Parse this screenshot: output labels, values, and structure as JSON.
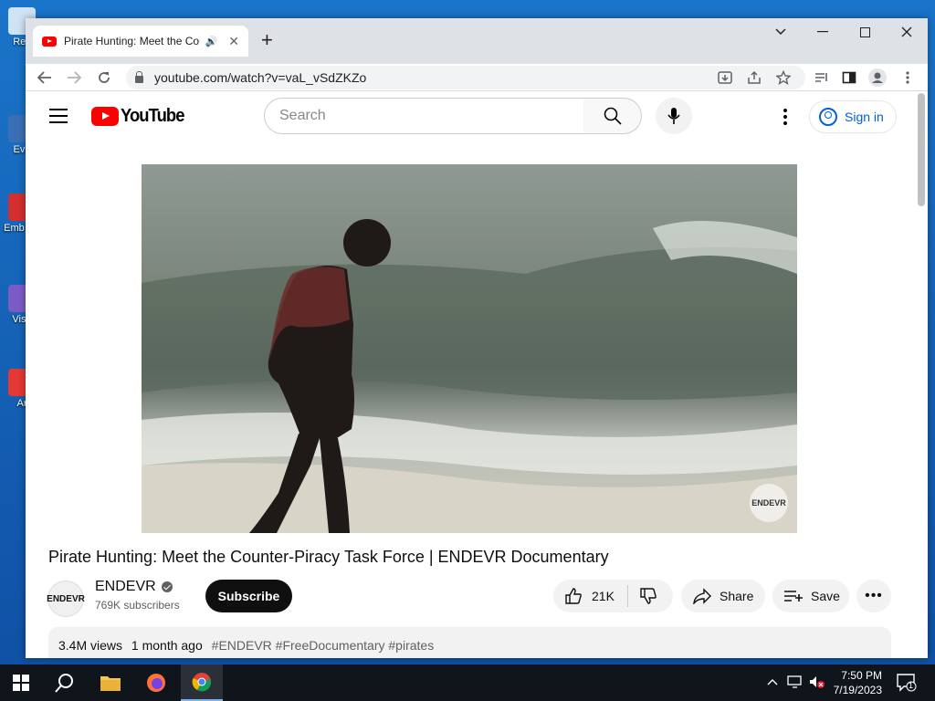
{
  "desktop": {
    "icons": [
      {
        "label": "Rec"
      },
      {
        "label": "Eve"
      },
      {
        "label": "Emb De"
      },
      {
        "label": "Visu"
      },
      {
        "label": "Ar"
      }
    ]
  },
  "browser": {
    "tab": {
      "title": "Pirate Hunting: Meet the Cou",
      "audio_icon": "speaker-icon"
    },
    "url": "youtube.com/watch?v=vaL_vSdZKZo"
  },
  "youtube": {
    "logo_text": "YouTube",
    "search_placeholder": "Search",
    "sign_in": "Sign in",
    "video": {
      "title": "Pirate Hunting: Meet the Counter-Piracy Task Force | ENDEVR Documentary",
      "watermark": "ENDEVR"
    },
    "channel": {
      "name": "ENDEVR",
      "avatar_text": "ENDEVR",
      "subscribers": "769K subscribers",
      "subscribe_label": "Subscribe"
    },
    "actions": {
      "likes": "21K",
      "share": "Share",
      "save": "Save",
      "more": "•••"
    },
    "description": {
      "views": "3.4M views",
      "age": "1 month ago",
      "tags": "#ENDEVR #FreeDocumentary #pirates"
    }
  },
  "taskbar": {
    "time": "7:50 PM",
    "date": "7/19/2023",
    "notification_count": "1"
  }
}
